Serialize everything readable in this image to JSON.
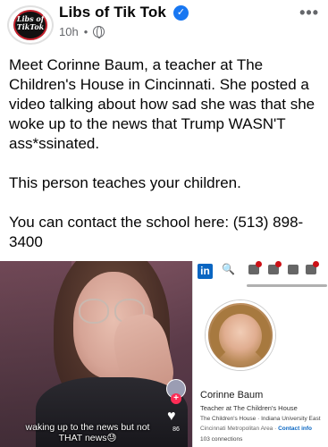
{
  "post": {
    "page_name": "Libs of Tik Tok",
    "time": "10h",
    "separator": "•",
    "more": "•••",
    "avatar_logo_line1": "Libs of",
    "avatar_logo_line2": "TikTok",
    "paragraphs": [
      "Meet Corinne Baum, a teacher at The Children's House in Cincinnati. She posted a video talking about how sad she was that she woke up to the news that Trump WASN'T ass*ssinated.",
      "This person teaches your children.",
      "You can contact the school here: (513) 898-3400"
    ]
  },
  "video": {
    "caption_line1": "waking up to the news but not",
    "caption_line2": "THAT news😓",
    "like_count": "86",
    "plus": "+"
  },
  "linkedin": {
    "logo": "in",
    "name": "Corinne Baum",
    "headline": "Teacher at The Children's House",
    "education": "The Children's House · Indiana University East",
    "location": "Cincinnati Metropolitan Area ·",
    "contact_info": "Contact info",
    "connections": "103 connections"
  },
  "icons": {
    "verified": "verified-badge-icon",
    "globe": "globe-icon",
    "heart": "heart-icon",
    "search": "search-icon"
  },
  "colors": {
    "verified_blue": "#1877f2",
    "linkedin_blue": "#0a66c2",
    "tiktok_red": "#fe2c55"
  }
}
